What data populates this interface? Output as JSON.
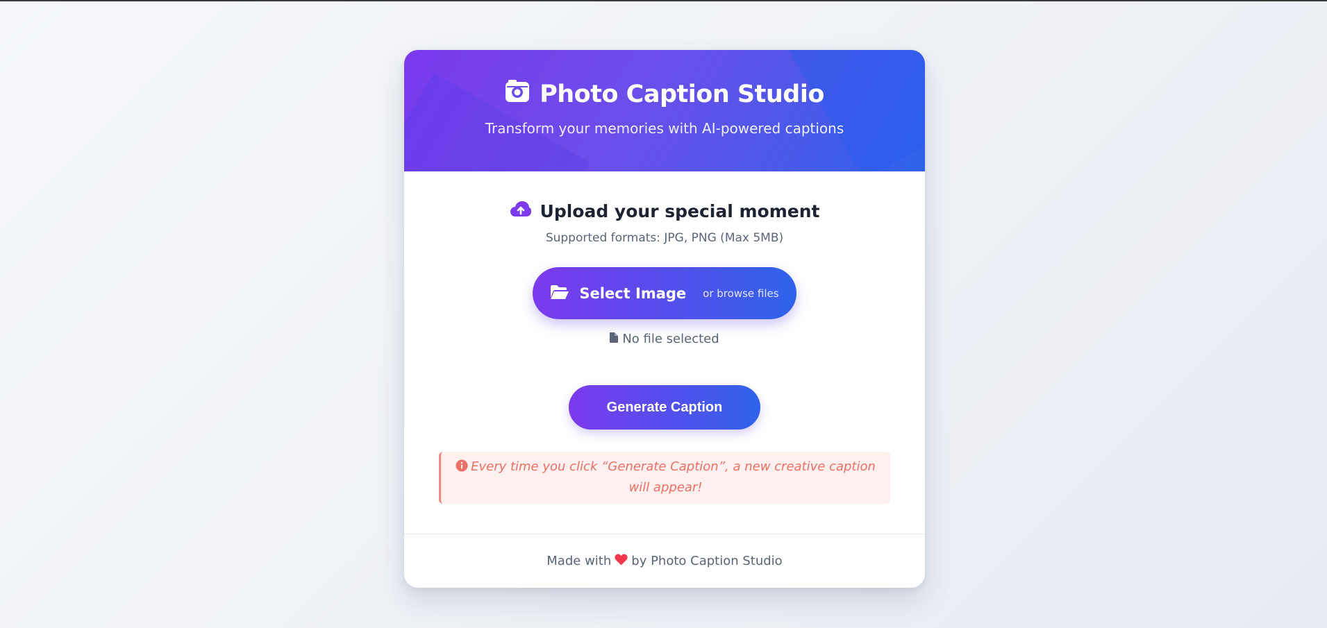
{
  "header": {
    "title": "Photo Caption Studio",
    "title_icon": "camera-icon",
    "subtitle": "Transform your memories with AI-powered captions"
  },
  "upload": {
    "title": "Upload your special moment",
    "title_icon": "cloud-upload-icon",
    "formats": "Supported formats: JPG, PNG (Max 5MB)",
    "select_label": "Select Image",
    "select_icon": "folder-open-icon",
    "browse_hint": "or browse files",
    "file_status": "No file selected",
    "file_icon": "file-icon"
  },
  "actions": {
    "generate_label": "Generate Caption"
  },
  "notice": {
    "icon": "info-icon",
    "text": "Every time you click “Generate Caption”, a new creative caption will appear!"
  },
  "footer": {
    "prefix": "Made with",
    "icon": "heart-icon",
    "suffix": "by Photo Caption Studio"
  },
  "colors": {
    "accent_purple": "#7c3aed",
    "accent_blue": "#2f63eb",
    "notice_text": "#ec7066",
    "heart": "#f0394f"
  }
}
